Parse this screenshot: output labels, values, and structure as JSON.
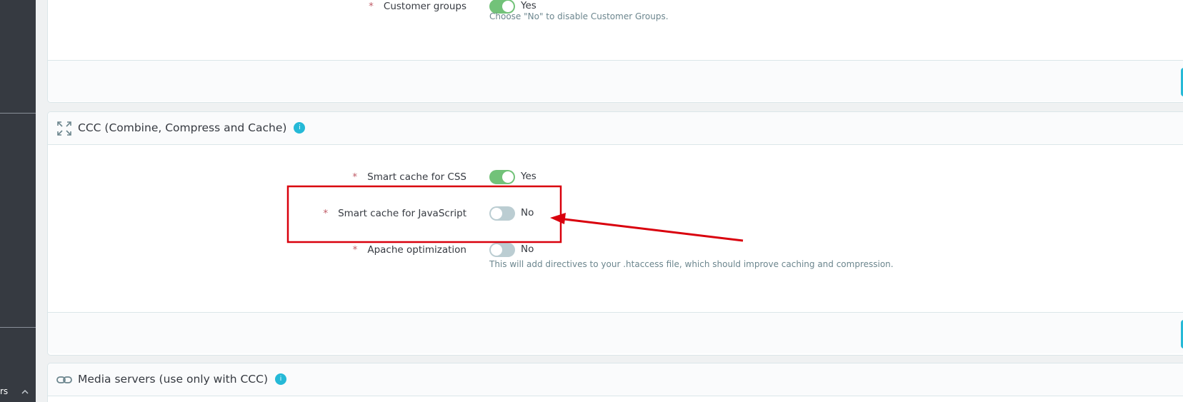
{
  "sidebar": {
    "footer_text": "rs"
  },
  "top_panel": {
    "field": {
      "label": "Customer groups",
      "value": "Yes",
      "on": true
    },
    "help": "Choose \"No\" to disable Customer Groups."
  },
  "ccc_panel": {
    "title": "CCC (Combine, Compress and Cache)",
    "info": "i",
    "fields": [
      {
        "label": "Smart cache for CSS",
        "value": "Yes",
        "on": true
      },
      {
        "label": "Smart cache for JavaScript",
        "value": "No",
        "on": false
      },
      {
        "label": "Apache optimization",
        "value": "No",
        "on": false
      }
    ],
    "apache_help": "This will add directives to your .htaccess file, which should improve caching and compression."
  },
  "media_panel": {
    "title": "Media servers (use only with CCC)",
    "info": "i"
  },
  "required_mark": "*",
  "colors": {
    "accent": "#25b9d7",
    "switch_on": "#72c279",
    "switch_off": "#bbcdd2",
    "annotation_red": "#d9000d"
  },
  "icons": {
    "ccc": "expand-arrows-icon",
    "media": "link-icon",
    "sidebar_toggle": "chevron-up-icon"
  }
}
